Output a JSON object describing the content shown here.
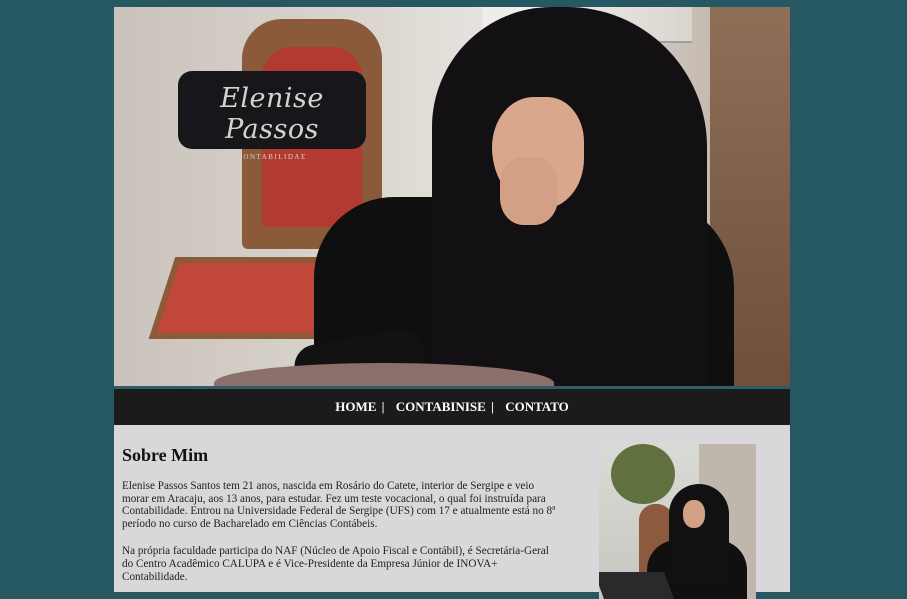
{
  "logo": {
    "name": "Elenise Passos",
    "subtitle": "CONTABILIDAE"
  },
  "nav": {
    "items": [
      {
        "label": "HOME"
      },
      {
        "label": "CONTABINISE"
      },
      {
        "label": "CONTATO"
      }
    ],
    "separator": "|"
  },
  "about": {
    "title": "Sobre Mim",
    "paragraph1": "Elenise Passos Santos tem 21 anos, nascida em Rosário do Catete, interior de Sergipe e veio morar em Aracaju, aos 13 anos, para estudar. Fez um teste vocacional, o qual foi instruída para Contabilidade. Entrou na Universidade Federal de Sergipe (UFS) com 17 e atualmente está no 8ª período no curso de Bacharelado em Ciências Contábeis.",
    "paragraph2": "Na própria faculdade participa do NAF (Núcleo de Apoio Fiscal e Contábil), é Secretária-Geral do Centro Acadêmico CALUPA e é Vice-Presidente da Empresa Júnior de INOVA+ Contabilidade."
  },
  "colors": {
    "background": "#255862",
    "navbar": "#1b1b1c",
    "content_bg": "#d8d7da",
    "accent_border": "#2f5e66"
  }
}
